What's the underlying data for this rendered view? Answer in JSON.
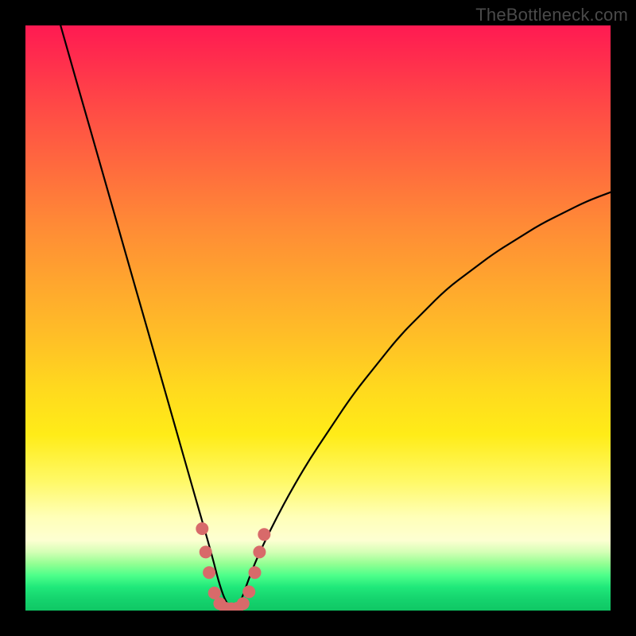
{
  "watermark": "TheBottleneck.com",
  "chart_data": {
    "type": "line",
    "title": "",
    "xlabel": "",
    "ylabel": "",
    "xlim": [
      0,
      100
    ],
    "ylim": [
      0,
      100
    ],
    "series": [
      {
        "name": "bottleneck-curve",
        "x": [
          6,
          8,
          10,
          12,
          14,
          16,
          18,
          20,
          22,
          24,
          26,
          28,
          30,
          32,
          33,
          34,
          35,
          36,
          37,
          38,
          40,
          44,
          48,
          52,
          56,
          60,
          64,
          68,
          72,
          76,
          80,
          84,
          88,
          92,
          96,
          100
        ],
        "y": [
          100,
          93,
          86,
          79,
          72,
          65,
          58,
          51,
          44,
          37,
          30,
          23,
          16,
          9,
          5,
          2,
          0.5,
          0.5,
          2,
          5,
          10,
          18,
          25,
          31,
          37,
          42,
          47,
          51,
          55,
          58,
          61,
          63.5,
          66,
          68,
          70,
          71.5
        ]
      }
    ],
    "markers": {
      "name": "valley-dots",
      "color": "#d86a6a",
      "points": [
        {
          "x": 30.2,
          "y": 14
        },
        {
          "x": 30.8,
          "y": 10
        },
        {
          "x": 31.4,
          "y": 6.5
        },
        {
          "x": 32.3,
          "y": 3
        },
        {
          "x": 33.2,
          "y": 1.2
        },
        {
          "x": 34.2,
          "y": 0.4
        },
        {
          "x": 35.2,
          "y": 0.3
        },
        {
          "x": 36.2,
          "y": 0.4
        },
        {
          "x": 37.2,
          "y": 1.2
        },
        {
          "x": 38.2,
          "y": 3.2
        },
        {
          "x": 39.2,
          "y": 6.5
        },
        {
          "x": 40.0,
          "y": 10
        },
        {
          "x": 40.8,
          "y": 13
        }
      ]
    }
  }
}
